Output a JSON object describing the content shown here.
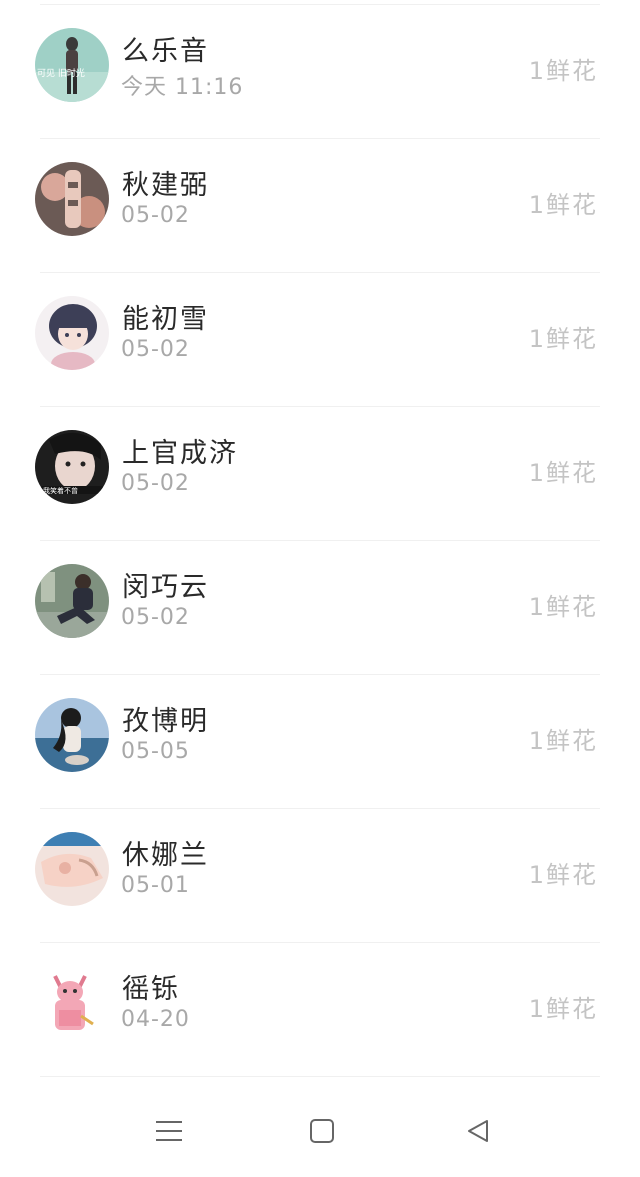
{
  "entries": [
    {
      "name": "么乐音",
      "date": "今天 11:16",
      "gift": "1鲜花",
      "avatar": "avatar-1"
    },
    {
      "name": "秋建弼",
      "date": "05-02",
      "gift": "1鲜花",
      "avatar": "avatar-2"
    },
    {
      "name": "能初雪",
      "date": "05-02",
      "gift": "1鲜花",
      "avatar": "avatar-3"
    },
    {
      "name": "上官成济",
      "date": "05-02",
      "gift": "1鲜花",
      "avatar": "avatar-4"
    },
    {
      "name": "闵巧云",
      "date": "05-02",
      "gift": "1鲜花",
      "avatar": "avatar-5"
    },
    {
      "name": "孜博明",
      "date": "05-05",
      "gift": "1鲜花",
      "avatar": "avatar-6"
    },
    {
      "name": "休娜兰",
      "date": "05-01",
      "gift": "1鲜花",
      "avatar": "avatar-7"
    },
    {
      "name": "徭铄",
      "date": "04-20",
      "gift": "1鲜花",
      "avatar": "avatar-8"
    }
  ],
  "navbar": {
    "menu_icon": "menu-icon",
    "home_icon": "home-square-icon",
    "back_icon": "back-triangle-icon"
  },
  "colors": {
    "name_text": "#2a2a2a",
    "date_text": "#a8a8a8",
    "gift_text": "#c4c4c4",
    "divider": "#f0f0f0",
    "nav_icon": "#666666"
  }
}
